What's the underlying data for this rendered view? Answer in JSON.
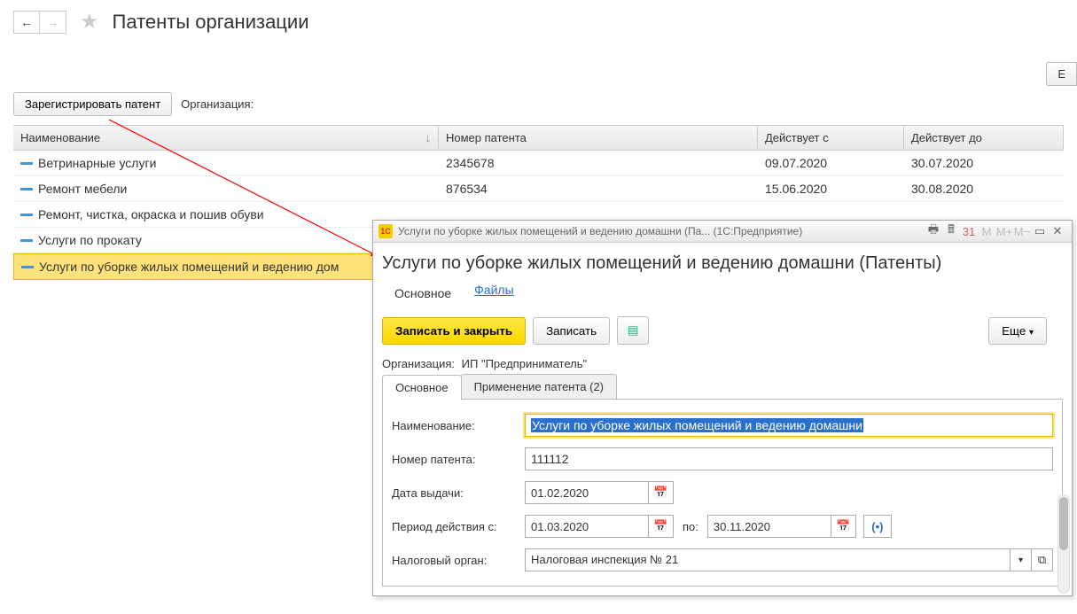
{
  "page": {
    "title": "Патенты организации"
  },
  "toolbar": {
    "register_btn": "Зарегистрировать патент",
    "org_label": "Организация:",
    "more_btn": "Е"
  },
  "table": {
    "headers": {
      "name": "Наименование",
      "num": "Номер патента",
      "from": "Действует с",
      "to": "Действует до"
    },
    "rows": [
      {
        "name": "Ветринарные услуги",
        "num": "2345678",
        "from": "09.07.2020",
        "to": "30.07.2020"
      },
      {
        "name": "Ремонт мебели",
        "num": "876534",
        "from": "15.06.2020",
        "to": "30.08.2020"
      },
      {
        "name": "Ремонт, чистка, окраска и пошив обуви",
        "num": "",
        "from": "",
        "to": ""
      },
      {
        "name": "Услуги по прокату",
        "num": "",
        "from": "",
        "to": ""
      },
      {
        "name": "Услуги по уборке жилых помещений и ведению дом",
        "num": "",
        "from": "",
        "to": ""
      }
    ]
  },
  "dialog": {
    "window_title": "Услуги по уборке жилых помещений и ведению домашни (Па...  (1С:Предприятие)",
    "heading": "Услуги по уборке жилых помещений и ведению домашни (Патенты)",
    "nav": {
      "main": "Основное",
      "files": "Файлы"
    },
    "buttons": {
      "save_close": "Записать и закрыть",
      "save": "Записать",
      "more": "Еще"
    },
    "org_label": "Организация:",
    "org_value": "ИП \"Предприниматель\"",
    "tabs": {
      "main": "Основное",
      "apply": "Применение патента (2)"
    },
    "form": {
      "name_label": "Наименование:",
      "name_value": "Услуги по уборке жилых помещений и ведению домашни",
      "num_label": "Номер патента:",
      "num_value": "111112",
      "issue_label": "Дата выдачи:",
      "issue_value": "01.02.2020",
      "period_label": "Период действия с:",
      "period_from": "01.03.2020",
      "period_to_label": "по:",
      "period_to": "30.11.2020",
      "tax_label": "Налоговый орган:",
      "tax_value": "Налоговая инспекция № 21"
    }
  }
}
